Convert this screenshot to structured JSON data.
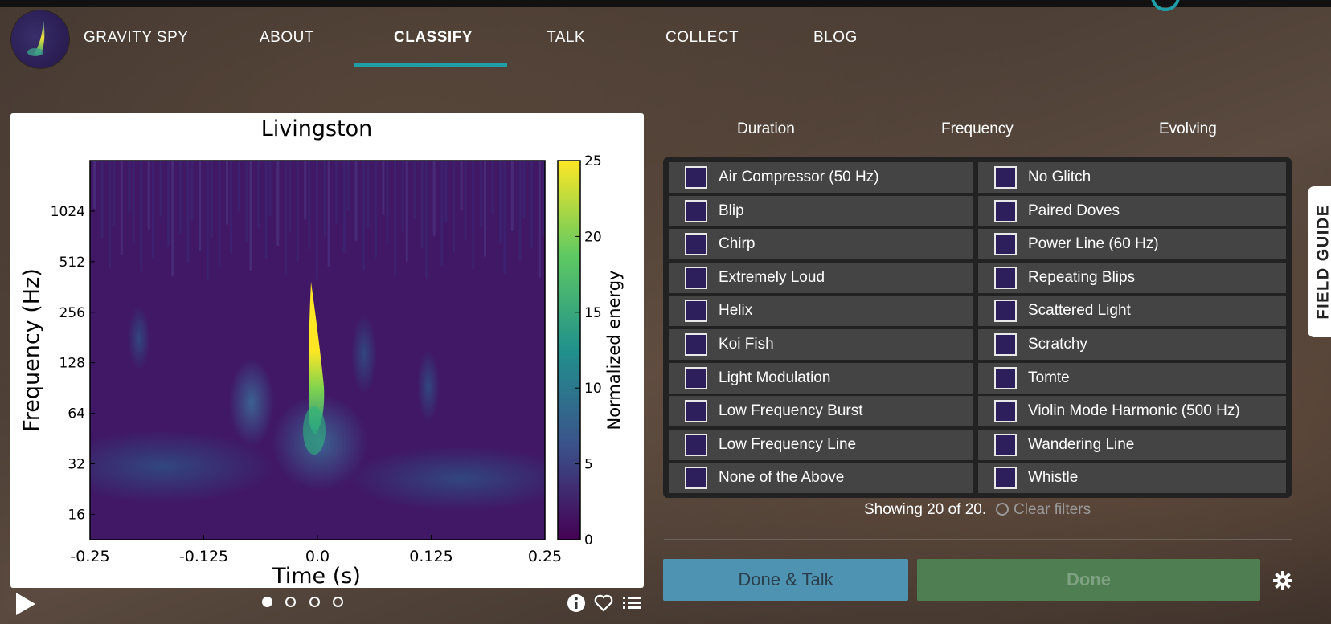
{
  "nav": {
    "brand": "GRAVITY SPY",
    "items": [
      {
        "label": "ABOUT"
      },
      {
        "label": "CLASSIFY",
        "active": true
      },
      {
        "label": "TALK"
      },
      {
        "label": "COLLECT"
      },
      {
        "label": "BLOG"
      }
    ],
    "accent_color": "#1f9ea8"
  },
  "chart_data": {
    "type": "heatmap",
    "title": "Livingston",
    "xlabel": "Time (s)",
    "ylabel": "Frequency (Hz)",
    "x_ticks": [
      "-0.25",
      "-0.125",
      "0.0",
      "0.125",
      "0.25"
    ],
    "xlim": [
      -0.25,
      0.25
    ],
    "y_ticks": [
      "16",
      "32",
      "64",
      "128",
      "256",
      "512",
      "1024"
    ],
    "y_scale": "log",
    "colorbar": {
      "label": "Normalized energy",
      "ticks": [
        "0",
        "5",
        "10",
        "15",
        "20",
        "25"
      ],
      "range": [
        0,
        25
      ],
      "colormap": "viridis"
    },
    "feature": "bright chirp-like blip centered near t=0.0 s, ~50–300 Hz, peak energy ≈25"
  },
  "viewer": {
    "frames": 4,
    "active_frame": 0,
    "icons": [
      "play-icon",
      "info-icon",
      "heart-icon",
      "list-icon"
    ]
  },
  "filters": {
    "tabs": [
      "Duration",
      "Frequency",
      "Evolving"
    ]
  },
  "choices": {
    "left": [
      "Air Compressor (50 Hz)",
      "Blip",
      "Chirp",
      "Extremely Loud",
      "Helix",
      "Koi Fish",
      "Light Modulation",
      "Low Frequency Burst",
      "Low Frequency Line",
      "None of the Above"
    ],
    "right": [
      "No Glitch",
      "Paired Doves",
      "Power Line (60 Hz)",
      "Repeating Blips",
      "Scattered Light",
      "Scratchy",
      "Tomte",
      "Violin Mode Harmonic (500 Hz)",
      "Wandering Line",
      "Whistle"
    ]
  },
  "status": {
    "showing": "Showing 20 of 20.",
    "clear_filters": "Clear filters"
  },
  "actions": {
    "done_talk": "Done & Talk",
    "done": "Done"
  },
  "field_guide": "FIELD GUIDE"
}
